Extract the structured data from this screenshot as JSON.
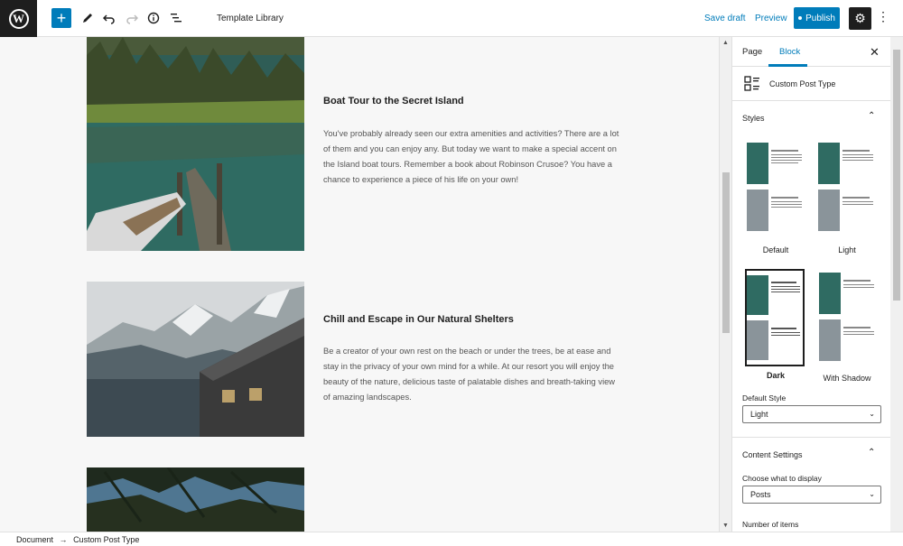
{
  "header": {
    "title": "Template Library",
    "save_draft": "Save draft",
    "preview": "Preview",
    "publish": "Publish",
    "add_icon": "plus-icon",
    "tools": [
      "pencil-icon",
      "undo-icon",
      "redo-icon",
      "info-icon",
      "list-view-icon"
    ]
  },
  "posts": [
    {
      "title": "Boat Tour to the Secret Island",
      "text": "You've probably already seen our extra amenities and activities? There are a lot of them and you can enjoy any. But today we want to make a special accent on the Island boat tours. Remember a book about Robinson Crusoe? You have a chance to experience a piece of his life on your own!"
    },
    {
      "title": "Chill and Escape in Our Natural Shelters",
      "text": "Be a creator of your own rest on the beach or under the trees, be at ease and stay in the privacy of your own mind for a while. At our resort you will enjoy the beauty of the nature, delicious taste of palatable dishes and breath-taking view of amazing landscapes."
    }
  ],
  "sidebar": {
    "tabs": [
      "Page",
      "Block"
    ],
    "active_tab": "Block",
    "block_name": "Custom Post Type",
    "styles_label": "Styles",
    "styles": [
      "Default",
      "Light",
      "Dark",
      "With Shadow"
    ],
    "selected_style": "Dark",
    "default_style_label": "Default Style",
    "default_style_value": "Light",
    "content_settings_label": "Content Settings",
    "choose_label": "Choose what to display",
    "choose_value": "Posts",
    "number_label": "Number of items"
  },
  "footer": {
    "doc": "Document",
    "arrow": "→",
    "block": "Custom Post Type"
  },
  "colors": {
    "accent": "#007cba",
    "dark": "#1e1e1e"
  }
}
